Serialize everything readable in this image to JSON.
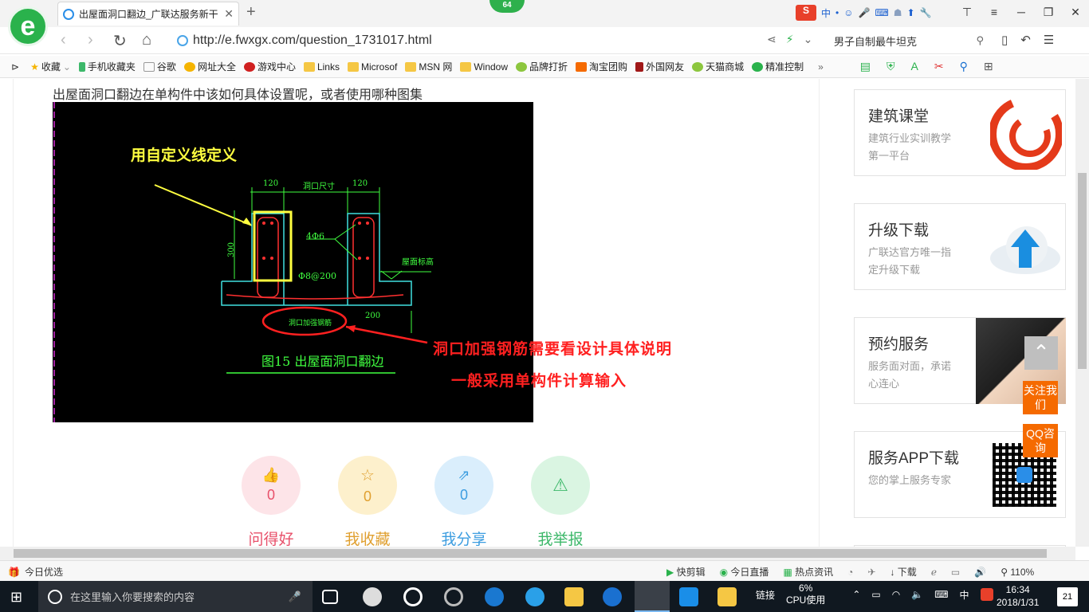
{
  "browser": {
    "tab_title": "出屋面洞口翻边_广联达服务新干",
    "badge": "64",
    "url": "http://e.fwxgx.com/question_1731017.html",
    "search_query": "男子自制最牛坦克",
    "bookmarks": [
      "收藏",
      "手机收藏夹",
      "谷歌",
      "网址大全",
      "游戏中心",
      "Links",
      "Microsof",
      "MSN 网",
      "Window",
      "品牌打折",
      "淘宝团购",
      "外国网友",
      "天猫商城",
      "精准控制"
    ]
  },
  "page": {
    "question": "出屋面洞口翻边在单构件中该如何具体设置呢，或者使用哪种图集",
    "cad_annotations": {
      "custom_line": "用自定义线定义",
      "dim_120_left": "120",
      "dim_opening": "洞口尺寸",
      "dim_120_right": "120",
      "dim_300": "300",
      "bars": "4Φ6",
      "stirrup": "Φ8@200",
      "roof_level": "屋面标高",
      "reinforce": "洞口加强钢筋",
      "dim_200": "200",
      "figure_caption": "图15  出屋面洞口翻边",
      "note_1": "洞口加强钢筋需要看设计具体说明",
      "note_2": "一般采用单构件计算输入"
    },
    "actions": [
      {
        "label": "问得好",
        "count": "0"
      },
      {
        "label": "我收藏",
        "count": "0"
      },
      {
        "label": "我分享",
        "count": "0"
      },
      {
        "label": "我举报",
        "count": "0"
      }
    ]
  },
  "sidebar": {
    "cards": [
      {
        "title": "建筑课堂",
        "subtitle": "建筑行业实训教学第一平台"
      },
      {
        "title": "升级下载",
        "subtitle": "广联达官方唯一指定升级下载"
      },
      {
        "title": "预约服务",
        "subtitle": "服务面对面，承诺心连心"
      },
      {
        "title": "服务APP下载",
        "subtitle": "您的掌上服务专家"
      }
    ],
    "follow_btn": "关注我们",
    "qq_btn": "QQ咨询"
  },
  "statusbar": {
    "left": "今日优选",
    "items": [
      "快剪辑",
      "今日直播",
      "热点资讯",
      "下载"
    ],
    "zoom": "110%"
  },
  "taskbar": {
    "search_placeholder": "在这里输入你要搜索的内容",
    "link_label": "链接",
    "cpu_percent": "6%",
    "cpu_label": "CPU使用",
    "ime": "中",
    "time": "16:34",
    "date": "2018/1/31",
    "notifications": "21"
  },
  "colors": {
    "accent_green": "#2ab24c",
    "orange": "#f56a00",
    "like": "#e8506a",
    "collect": "#e0a030",
    "share": "#3c9de0",
    "report": "#3db86a"
  }
}
